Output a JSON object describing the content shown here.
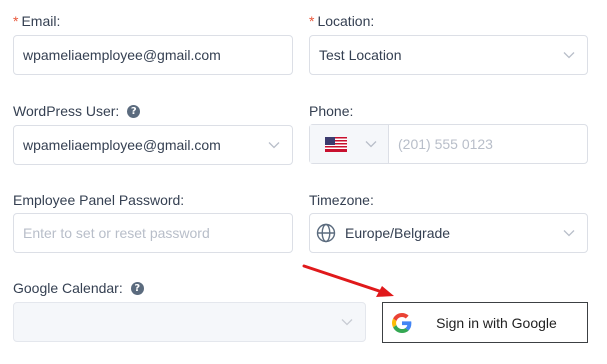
{
  "form": {
    "email": {
      "label": "Email",
      "value": "wpameliaemployee@gmail.com",
      "required": true
    },
    "location": {
      "label": "Location",
      "selected": "Test Location",
      "required": true
    },
    "wordpress_user": {
      "label": "WordPress User:",
      "selected": "wpameliaemployee@gmail.com"
    },
    "phone": {
      "label": "Phone:",
      "country_flag": "us-flag-icon",
      "placeholder": "(201) 555 0123"
    },
    "password": {
      "label": "Employee Panel Password:",
      "placeholder": "Enter to set or reset password"
    },
    "timezone": {
      "label": "Timezone:",
      "selected": "Europe/Belgrade",
      "icon": "globe-icon"
    },
    "google_calendar": {
      "label": "Google Calendar:",
      "selected": ""
    },
    "google_signin": {
      "label": "Sign in with Google"
    }
  },
  "required_marker": "*",
  "help_marker": "?",
  "colors": {
    "required": "#e8573a",
    "border": "#dcdfe6",
    "annotation_arrow": "#e0191b"
  }
}
